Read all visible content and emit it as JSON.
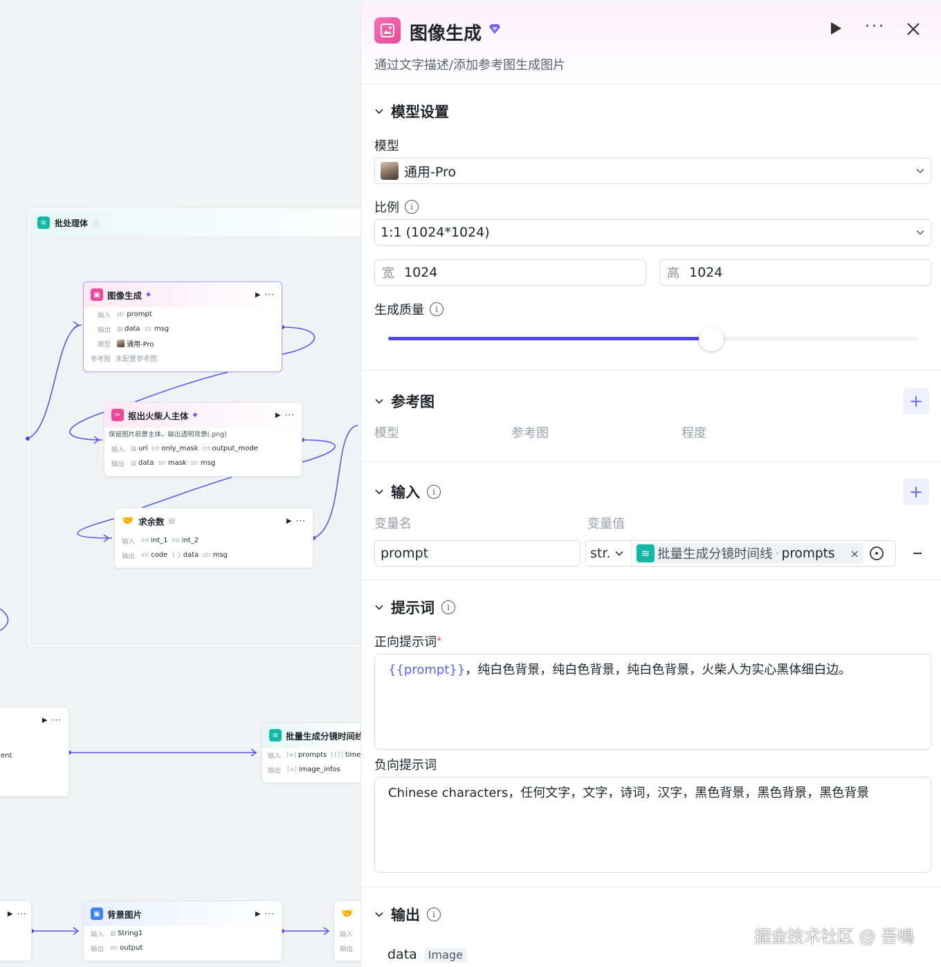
{
  "canvas": {
    "batch": {
      "title": "批处理体",
      "info_icon": "ⓘ"
    },
    "nodes": {
      "image_gen": {
        "title": "图像生成",
        "input_label": "输入",
        "input_type": "str",
        "input_name": "prompt",
        "output_label": "输出",
        "output_data": "data",
        "output_type": "str",
        "output_msg": "msg",
        "model_label": "模型",
        "model_name": "通用-Pro",
        "ref_label": "参考图",
        "ref_value": "未配置参考图"
      },
      "cutout": {
        "title": "抠出火柴人主体",
        "desc": "保留图片前景主体，输出透明背景(.png)",
        "input_label": "输入",
        "in1": "url",
        "in2_type": "int",
        "in2": "only_mask",
        "in3_type": "int",
        "in3": "output_mode",
        "output_label": "输出",
        "out1": "data",
        "out2_type": "str",
        "out2": "mask",
        "out3_type": "str",
        "out3": "msg"
      },
      "mod": {
        "title": "求余数",
        "input_label": "输入",
        "in1_type": "int",
        "in1": "int_1",
        "in2_type": "int",
        "in2": "int_2",
        "output_label": "输出",
        "out1_type": "int",
        "out1": "code",
        "out2_type": "{ }",
        "out2": "data",
        "out3_type": "str",
        "out3": "msg"
      },
      "batch_timeline": {
        "title": "批量生成分镜时间线",
        "input_label": "输入",
        "in1": "prompts",
        "in2": "timeli",
        "output_label": "输出",
        "out1": "image_infos"
      },
      "left_stub": {
        "label": "ent"
      },
      "bg_image": {
        "title": "背景图片",
        "input_label": "输入",
        "in1": "String1",
        "output_label": "输出",
        "out1_type": "str",
        "out1": "output"
      },
      "bottom_stub": {
        "input_label": "输入",
        "output_label": "输出"
      }
    }
  },
  "panel": {
    "title": "图像生成",
    "description": "通过文字描述/添加参考图生成图片",
    "model_section": {
      "title": "模型设置",
      "model_label": "模型",
      "model_value": "通用-Pro",
      "ratio_label": "比例",
      "ratio_value": "1:1 (1024*1024)",
      "width_prefix": "宽",
      "width_value": "1024",
      "height_prefix": "高",
      "height_value": "1024",
      "quality_label": "生成质量",
      "quality_level": 0.61
    },
    "reference_section": {
      "title": "参考图",
      "columns": [
        "模型",
        "参考图",
        "程度"
      ]
    },
    "input_section": {
      "title": "输入",
      "col_name": "变量名",
      "col_value": "变量值",
      "var_name": "prompt",
      "var_type": "str.",
      "ref_node": "批量生成分镜时间线",
      "ref_sep": "-",
      "ref_field": "prompts"
    },
    "prompt_section": {
      "title": "提示词",
      "positive_label": "正向提示词",
      "required_mark": "*",
      "positive_var": "{{prompt}}",
      "positive_text": "，纯白色背景，纯白色背景，纯白色背景，火柴人为实心黑体细白边。",
      "negative_label": "负向提示词",
      "negative_text": "Chinese characters，任何文字，文字，诗词，汉字，黑色背景，黑色背景，黑色背景"
    },
    "output_section": {
      "title": "输出",
      "output_name": "data",
      "output_type": "Image"
    }
  },
  "watermark": "掘金技术社区 @ 吾鳴",
  "colors": {
    "accent": "#4f46e5",
    "pink": "#ec4899",
    "teal": "#14b8a6",
    "wire": "#4f46e5"
  },
  "icons": [
    "image-icon",
    "gem-icon",
    "play-icon",
    "more-icon",
    "close-icon",
    "chevron-down-icon",
    "info-icon",
    "plus-icon",
    "minus-icon",
    "layers-icon",
    "x-icon",
    "target-icon"
  ]
}
